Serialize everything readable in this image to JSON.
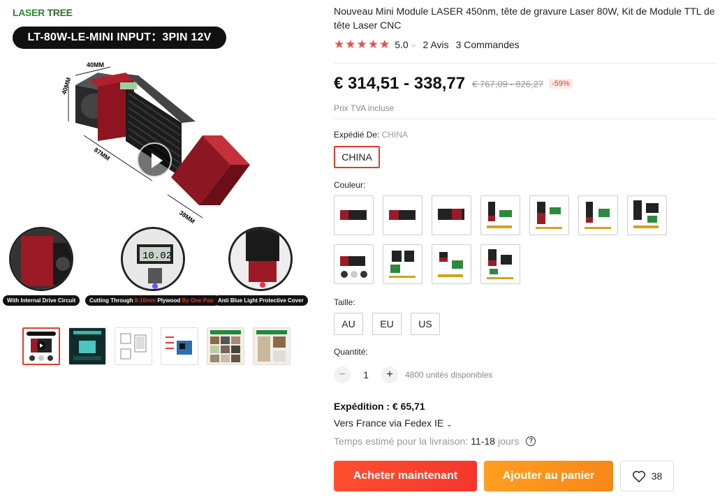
{
  "gallery": {
    "brand": {
      "laser": "LASER",
      "tree": " TREE"
    },
    "model_banner": "LT-80W-LE-MINI INPUT：3PIN 12V",
    "dimensions": {
      "width": "40MM",
      "height": "40MM",
      "length": "87MM",
      "cover": "38MM"
    },
    "features": [
      {
        "caption": "With Internal Drive Circuit"
      },
      {
        "caption_pre": "Cutting Through ",
        "caption_red": "8-10mm",
        "caption_mid": " Plywood ",
        "caption_red2": "By One Pass",
        "display": "10.02"
      },
      {
        "caption": "Anti Blue Light Protective Cover"
      }
    ],
    "thumbnail_count": 6,
    "active_thumbnail": 0
  },
  "product": {
    "title": "Nouveau Mini Module LASER 450nm, tête de gravure Laser 80W, Kit de Module TTL de tête Laser CNC",
    "stars": "★★★★★",
    "rating": "5.0",
    "reviews": "2 Avis",
    "orders": "3 Commandes",
    "price": "€ 314,51 - 338,77",
    "old_price": "€ 767,09 - 826,27",
    "discount": "-59%",
    "tax_note": "Prix TVA incluse"
  },
  "options": {
    "ship_from_label": "Expédié De:",
    "ship_from_value": "CHINA",
    "ship_from_selected": "CHINA",
    "color_label": "Couleur:",
    "color_swatch_count": 11,
    "size_label": "Taille:",
    "sizes": [
      "AU",
      "EU",
      "US"
    ],
    "quantity_label": "Quantité:",
    "quantity_value": "1",
    "stock": "4800 unités disponibles"
  },
  "shipping": {
    "title": "Expédition : € 65,71",
    "via": "Vers France via Fedex IE",
    "estimate_label": "Temps estimé pour la livraison:",
    "estimate_days": "11-18",
    "estimate_unit": "jours"
  },
  "actions": {
    "buy_now": "Acheter maintenant",
    "add_to_cart": "Ajouter au panier",
    "wishlist_count": "38"
  },
  "colors": {
    "accent_red": "#e23a2a",
    "buy_button": "#ff4f2e",
    "cart_button": "#ff9e20",
    "star": "#ee4d4d"
  }
}
